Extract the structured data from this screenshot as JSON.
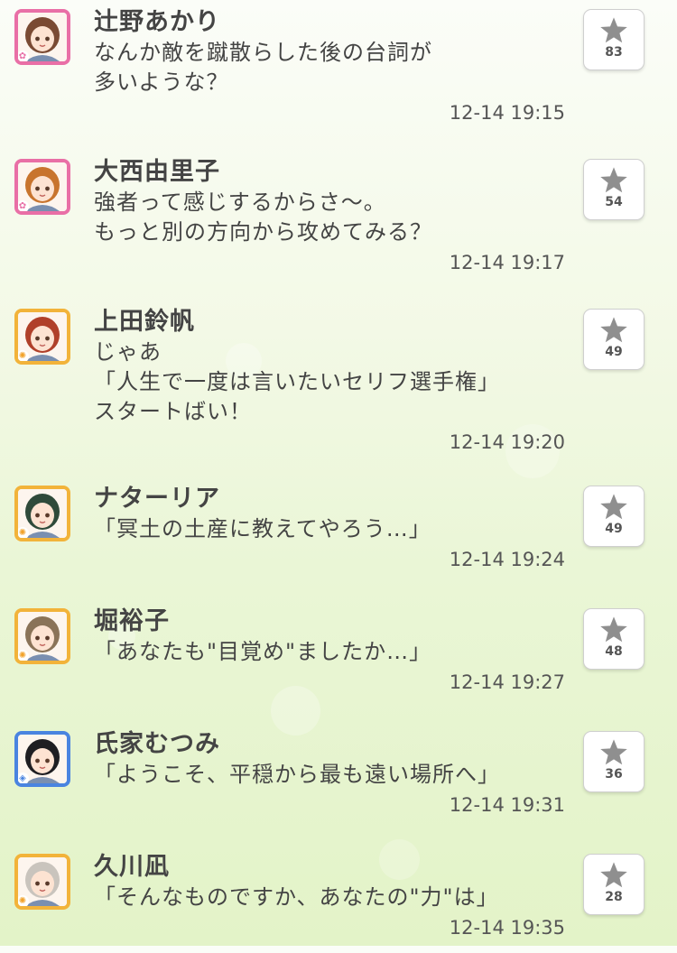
{
  "posts": [
    {
      "name": "辻野あかり",
      "lines": [
        "なんか敵を蹴散らした後の台詞が",
        "多いような？"
      ],
      "time": "12-14 19:15",
      "likes": "83",
      "attribute": "cute",
      "hair": "#7a4a33"
    },
    {
      "name": "大西由里子",
      "lines": [
        "強者って感じするからさ～。",
        "もっと別の方向から攻めてみる？"
      ],
      "time": "12-14 19:17",
      "likes": "54",
      "attribute": "cute",
      "hair": "#c8742e"
    },
    {
      "name": "上田鈴帆",
      "lines": [
        "じゃあ",
        "「人生で一度は言いたいセリフ選手権」",
        "スタートばい！"
      ],
      "time": "12-14 19:20",
      "likes": "49",
      "attribute": "passion",
      "hair": "#b0402a"
    },
    {
      "name": "ナターリア",
      "lines": [
        "「冥土の土産に教えてやろう…」"
      ],
      "time": "12-14 19:24",
      "likes": "49",
      "attribute": "passion",
      "hair": "#2f4a3a"
    },
    {
      "name": "堀裕子",
      "lines": [
        "「あなたも\"目覚め\"ましたか…」"
      ],
      "time": "12-14 19:27",
      "likes": "48",
      "attribute": "passion",
      "hair": "#8a7358"
    },
    {
      "name": "氏家むつみ",
      "lines": [
        "「ようこそ、平穏から最も遠い場所へ」"
      ],
      "time": "12-14 19:31",
      "likes": "36",
      "attribute": "cool",
      "hair": "#1e1e22"
    },
    {
      "name": "久川凪",
      "lines": [
        "「そんなものですか、あなたの\"力\"は」"
      ],
      "time": "12-14 19:35",
      "likes": "28",
      "attribute": "passion",
      "hair": "#c9c4bd"
    }
  ],
  "icons": {
    "like": "star-icon",
    "attribute_marks": {
      "cute": "✿",
      "passion": "✺",
      "cool": "◈"
    }
  },
  "colors": {
    "cute": "#e96fa6",
    "passion": "#f2b33a",
    "cool": "#4a84e0",
    "star": "#8f8f8f"
  }
}
